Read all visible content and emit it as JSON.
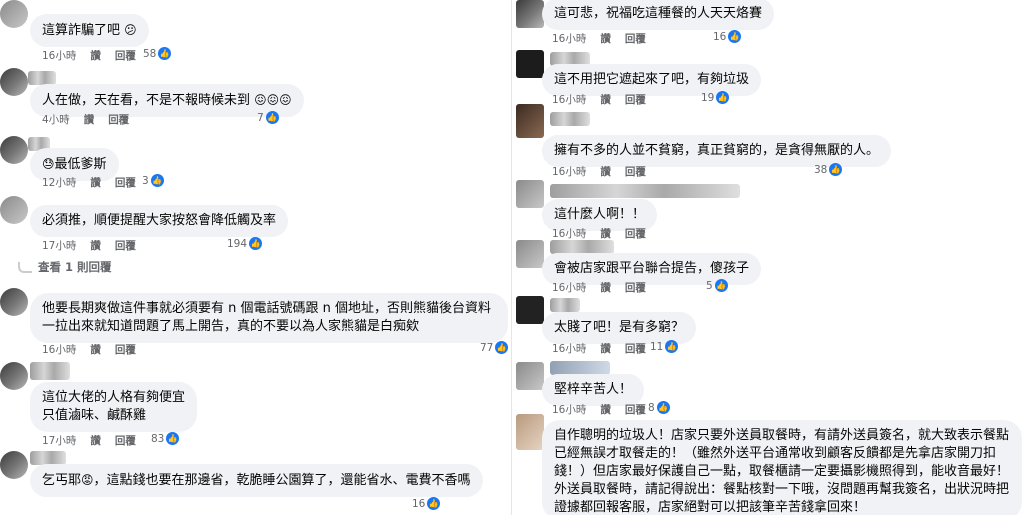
{
  "labels": {
    "like": "讚",
    "reply": "回覆",
    "like_glyph": "👍"
  },
  "colors": {
    "bubble": "#f0f2f5",
    "like_blue": "#1877f2",
    "meta_gray": "#65676b"
  },
  "left": [
    {
      "text": "這算詐騙了吧",
      "emoji": "😕",
      "time": "16小時",
      "likes": "58"
    },
    {
      "text": "人在做，天在看，不是不報時候未到",
      "emoji": "😖😖😖",
      "time": "4小時",
      "likes": "7"
    },
    {
      "emoji_lead": "😓",
      "text": "最低爹斯",
      "time": "12小時",
      "likes": "3"
    },
    {
      "text": "必須推，順便提醒大家按怒會降低觸及率",
      "time": "17小時",
      "likes": "194",
      "replies": "查看 1 則回覆"
    },
    {
      "text": "他要長期爽做這件事就必須要有 n 個電話號碼跟 n 個地址，否則熊貓後台資料一拉出來就知道問題了馬上開告，真的不要以為人家熊貓是白痴欸",
      "time": "16小時",
      "likes": "77"
    },
    {
      "text": "這位大佬的人格有夠便宜\n只值滷味、鹹酥雞",
      "time": "17小時",
      "likes": "83"
    },
    {
      "text": "乞丐耶",
      "emoji": "😡",
      "text2": "，這點錢也要在那邊省，乾脆睡公園算了，還能省水、電費不香嗎",
      "time": "",
      "likes": "16"
    }
  ],
  "right": [
    {
      "text": "這可悲，祝福吃這種餐的人天天烙賽",
      "time": "16小時",
      "likes": "16"
    },
    {
      "text": "這不用把它遮起來了吧，有夠垃圾",
      "time": "16小時",
      "likes": "19"
    },
    {
      "text": "擁有不多的人並不貧窮，真正貧窮的，是貪得無厭的人。",
      "time": "16小時",
      "likes": "38"
    },
    {
      "text": "這什麼人啊！！",
      "time": "16小時",
      "likes": ""
    },
    {
      "text": "會被店家跟平台聯合提告，傻孩子",
      "time": "16小時",
      "likes": "5"
    },
    {
      "text": "太賤了吧！是有多窮？",
      "time": "16小時",
      "likes": "11"
    },
    {
      "text": "堅梓辛苦人！",
      "time": "16小時",
      "likes": "8"
    },
    {
      "text": "自作聰明的垃圾人！店家只要外送員取餐時，有請外送員簽名，就大致表示餐點已經無誤才取餐走的！（雖然外送平台通常收到顧客反饋都是先拿店家開刀扣錢！）但店家最好保護自己一點，取餐櫃請一定要攝影機照得到，能收音最好！外送員取餐時，請記得說出：餐點核對一下哦，沒問題再幫我簽名，出狀況時把證據都回報客服，店家絕對可以把該筆辛苦錢拿回來！",
      "time": "",
      "likes": ""
    }
  ]
}
